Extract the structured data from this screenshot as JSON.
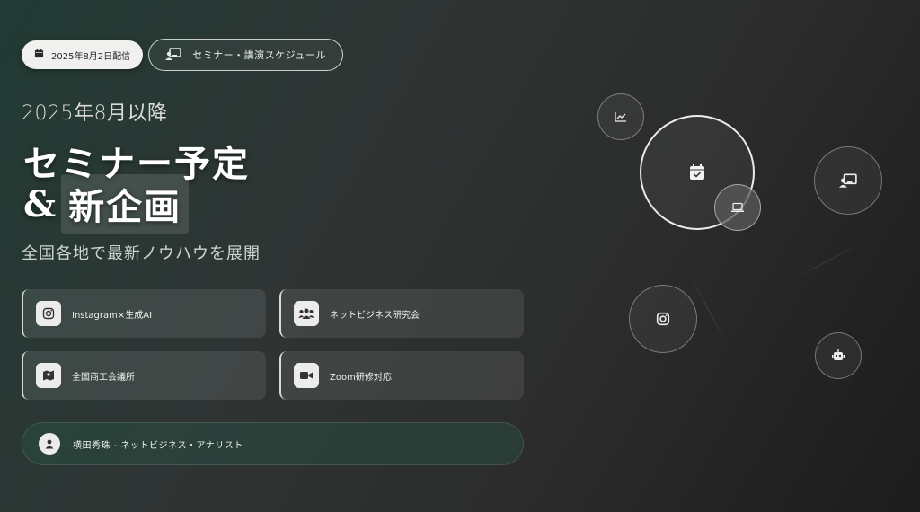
{
  "header": {
    "date_badge": "2025年8月2日配信",
    "schedule_button": "セミナー・講演スケジュール"
  },
  "hero": {
    "subhead": "2025年8月以降",
    "title_line1": "セミナー予定",
    "title_amp": "&",
    "title_highlight": "新企画",
    "tagline": "全国各地で最新ノウハウを展開"
  },
  "features": [
    {
      "label": "Instagram×生成AI",
      "icon": "instagram-icon"
    },
    {
      "label": "ネットビジネス研究会",
      "icon": "users-icon"
    },
    {
      "label": "全国商工会議所",
      "icon": "map-icon"
    },
    {
      "label": "Zoom研修対応",
      "icon": "video-icon"
    }
  ],
  "author": {
    "label": "横田秀珠 - ネットビジネス・アナリスト",
    "icon": "user-icon"
  },
  "decor_icons": [
    "chart-line-icon",
    "calendar-check-icon",
    "laptop-icon",
    "presentation-icon",
    "instagram-icon",
    "robot-icon"
  ],
  "colors": {
    "background_start": "#223b34",
    "background_end": "#1c1c1c",
    "accent_green": "#2c5a4a",
    "card_icon_bg": "#ececea"
  }
}
